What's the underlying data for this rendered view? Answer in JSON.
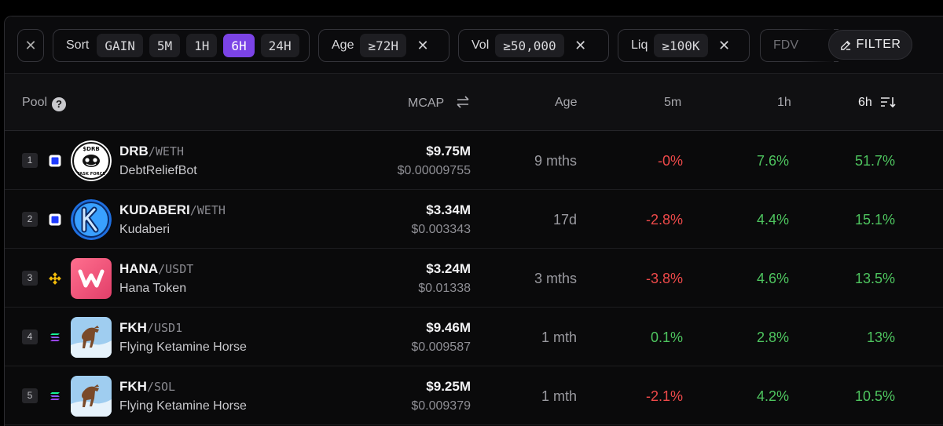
{
  "toolbar": {
    "close_icon": "close-icon",
    "sort": {
      "label": "Sort",
      "options": [
        "GAIN",
        "5M",
        "1H",
        "6H",
        "24H"
      ],
      "active": "6H"
    },
    "age": {
      "label": "Age",
      "value": "≥72H"
    },
    "vol": {
      "label": "Vol",
      "value": "≥50,000"
    },
    "liq": {
      "label": "Liq",
      "value": "≥100K"
    },
    "fdv": {
      "label": "FDV"
    },
    "filter_label": "FILTER"
  },
  "columns": {
    "pool": "Pool",
    "mcap": "MCAP",
    "age": "Age",
    "m5": "5m",
    "h1": "1h",
    "h6": "6h"
  },
  "rows": [
    {
      "rank": "1",
      "chain": "base",
      "base": "DRB",
      "quote": "/WETH",
      "name": "DebtReliefBot",
      "mcap": "$9.75M",
      "price": "$0.00009755",
      "age": "9 mths",
      "m5": "-0%",
      "h1": "7.6%",
      "h6": "51.7%"
    },
    {
      "rank": "2",
      "chain": "base",
      "base": "KUDABERI",
      "quote": "/WETH",
      "name": "Kudaberi",
      "mcap": "$3.34M",
      "price": "$0.003343",
      "age": "17d",
      "m5": "-2.8%",
      "h1": "4.4%",
      "h6": "15.1%"
    },
    {
      "rank": "3",
      "chain": "bsc",
      "base": "HANA",
      "quote": "/USDT",
      "name": "Hana Token",
      "mcap": "$3.24M",
      "price": "$0.01338",
      "age": "3 mths",
      "m5": "-3.8%",
      "h1": "4.6%",
      "h6": "13.5%"
    },
    {
      "rank": "4",
      "chain": "solana",
      "base": "FKH",
      "quote": "/USD1",
      "name": "Flying Ketamine Horse",
      "mcap": "$9.46M",
      "price": "$0.009587",
      "age": "1 mth",
      "m5": "0.1%",
      "h1": "2.8%",
      "h6": "13%"
    },
    {
      "rank": "5",
      "chain": "solana",
      "base": "FKH",
      "quote": "/SOL",
      "name": "Flying Ketamine Horse",
      "mcap": "$9.25M",
      "price": "$0.009379",
      "age": "1 mth",
      "m5": "-2.1%",
      "h1": "4.2%",
      "h6": "10.5%"
    }
  ],
  "colors": {
    "accent": "#7b43e6",
    "positive": "#4ec55f",
    "negative": "#ef4a4a"
  },
  "drb_logo_text": [
    "$DRB",
    "TASK FORCE"
  ]
}
